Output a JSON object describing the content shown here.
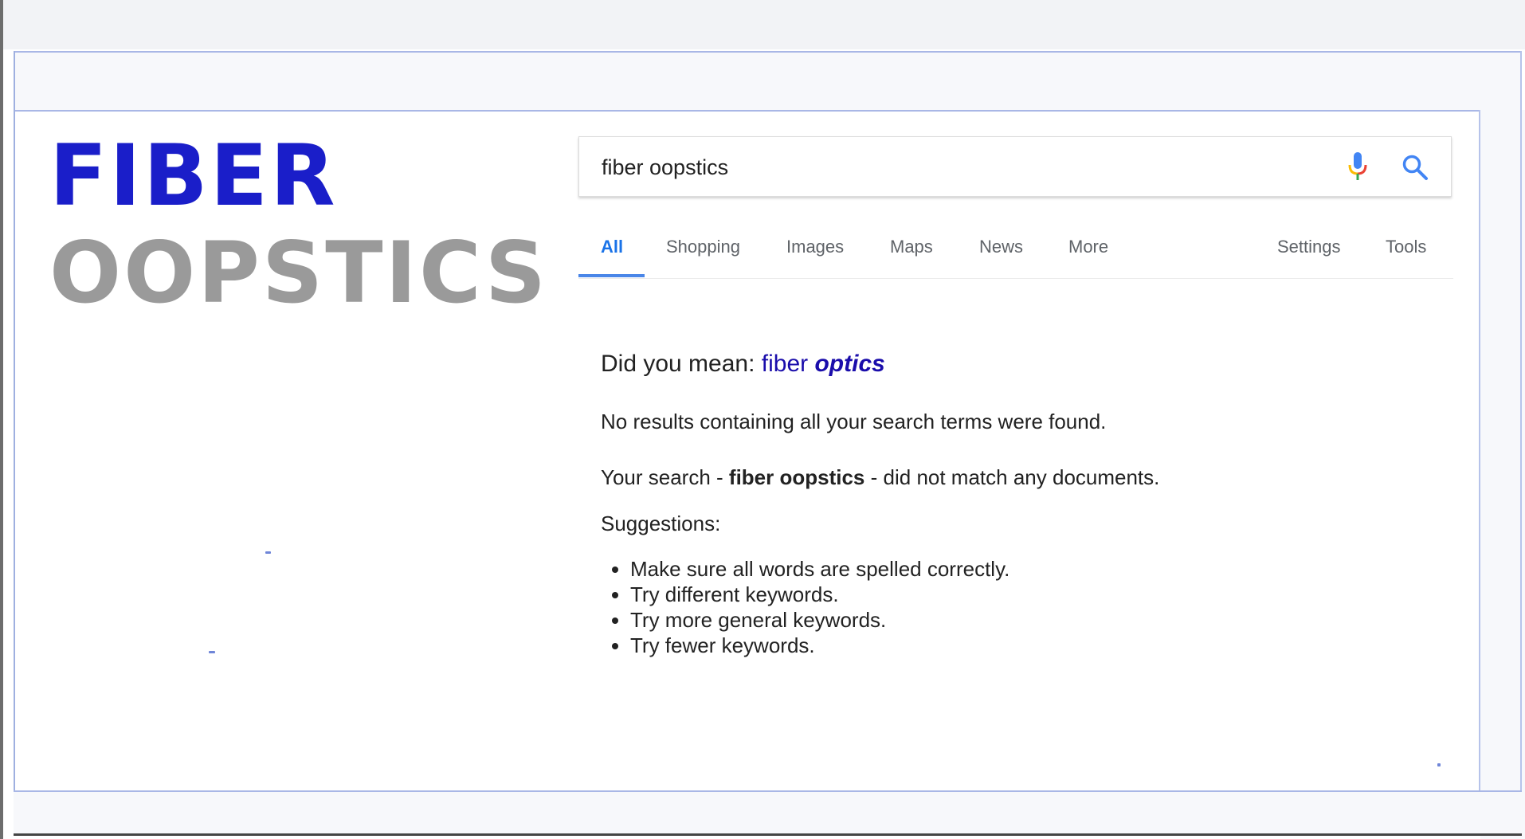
{
  "headline": {
    "line1": "FIBER",
    "line2": "OOPSTICS"
  },
  "search": {
    "query": "fiber oopstics"
  },
  "tabs": {
    "all": "All",
    "shopping": "Shopping",
    "images": "Images",
    "maps": "Maps",
    "news": "News",
    "more": "More",
    "settings": "Settings",
    "tools": "Tools",
    "active": "All"
  },
  "results": {
    "did_you_mean_prefix": "Did you mean:",
    "suggestion_plain": "fiber",
    "suggestion_emphasized": "optics",
    "no_results": "No results containing all your search terms were found.",
    "your_search_prefix": "Your search -",
    "your_search_query": "fiber oopstics",
    "your_search_suffix": "- did not match any documents.",
    "suggestions_title": "Suggestions:",
    "suggestions": [
      "Make sure all words are spelled correctly.",
      "Try different keywords.",
      "Try more general keywords.",
      "Try fewer keywords."
    ]
  },
  "colors": {
    "headline_primary": "#1a1ec9",
    "headline_secondary": "#9a9a9a",
    "link": "#1a0dab",
    "active_tab": "#1a73e8"
  },
  "icons": {
    "mic": "microphone-icon",
    "search": "search-icon"
  }
}
